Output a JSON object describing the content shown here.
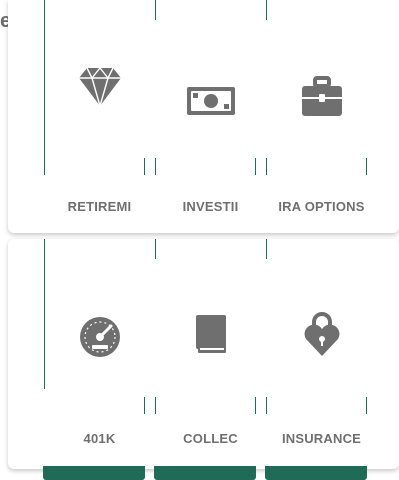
{
  "clipped_heading": "er.",
  "row1": {
    "tiles": [
      {
        "label": "RETIREMI",
        "icon": "diamond-icon"
      },
      {
        "label": "INVESTII",
        "icon": "money-icon"
      },
      {
        "label": "IRA OPTIONS",
        "icon": "briefcase-icon"
      }
    ]
  },
  "row2": {
    "tiles": [
      {
        "label": "401K",
        "icon": "speedometer-icon"
      },
      {
        "label": "COLLEC",
        "icon": "book-icon"
      },
      {
        "label": "INSURANCE",
        "icon": "lock-heart-icon"
      }
    ]
  },
  "colors": {
    "accent": "#1f6b57",
    "icon": "#6f6f6f",
    "text": "#6f6f6f"
  }
}
